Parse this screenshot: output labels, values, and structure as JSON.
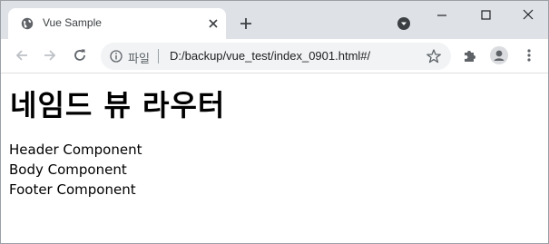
{
  "window": {
    "controls": {
      "minimize": "minimize",
      "maximize": "maximize",
      "close": "close"
    }
  },
  "tab": {
    "title": "Vue Sample",
    "favicon": "globe-icon"
  },
  "toolbar": {
    "back": "arrow-left-icon",
    "forward": "arrow-right-icon",
    "reload": "reload-icon",
    "scheme_label": "파일",
    "url": "D:/backup/vue_test/index_0901.html#/",
    "bookmark": "star-icon",
    "extensions": "puzzle-icon",
    "profile": "avatar",
    "menu": "kebab-menu-icon"
  },
  "page": {
    "heading": "네임드 뷰 라우터",
    "components": [
      "Header Component",
      "Body Component",
      "Footer Component"
    ]
  }
}
